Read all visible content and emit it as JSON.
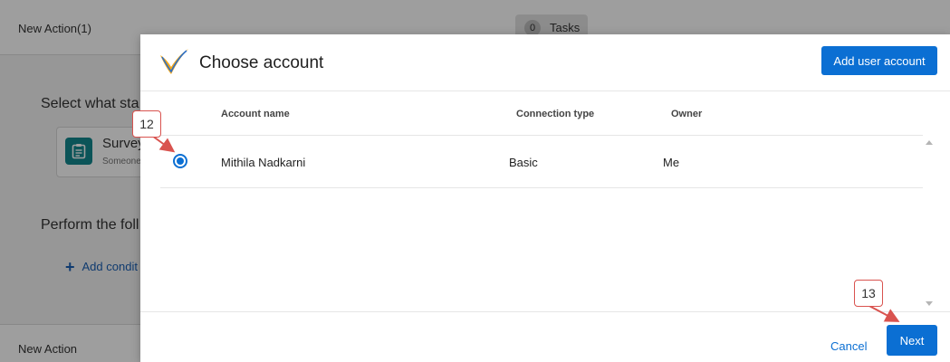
{
  "background": {
    "header_title": "New Action(1)",
    "tasks_count": "0",
    "tasks_label": "Tasks",
    "section_select": "Select what sta",
    "survey_card": {
      "title": "Survey",
      "subtitle": "Someone"
    },
    "section_perform": "Perform the foll",
    "add_condition": "Add condit",
    "footer_title": "New Action"
  },
  "modal": {
    "title": "Choose account",
    "add_account_button": "Add user account",
    "columns": {
      "account_name": "Account name",
      "connection_type": "Connection type",
      "owner": "Owner"
    },
    "rows": [
      {
        "selected": true,
        "account_name": "Mithila Nadkarni",
        "connection_type": "Basic",
        "owner": "Me"
      }
    ],
    "cancel_label": "Cancel",
    "next_label": "Next"
  },
  "callouts": {
    "step_1": "12",
    "step_2": "13"
  },
  "colors": {
    "accent": "#0b6fd3",
    "callout_border": "#d9534f",
    "survey_icon_bg": "#13888f"
  },
  "icons": {
    "logo": "checkmark-logo-icon",
    "survey": "clipboard-icon",
    "add": "plus-icon",
    "scroll_up": "scroll-up-arrow-icon",
    "scroll_down": "scroll-down-arrow-icon"
  }
}
